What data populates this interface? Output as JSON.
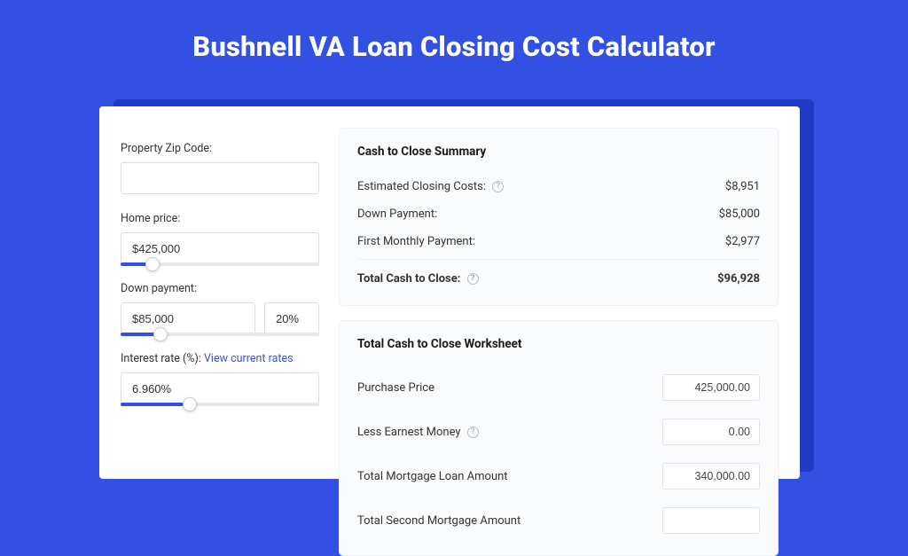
{
  "title": "Bushnell VA Loan Closing Cost Calculator",
  "left": {
    "zip": {
      "label": "Property Zip Code:",
      "value": ""
    },
    "price": {
      "label": "Home price:",
      "value": "$425,000",
      "slider_pct": 16
    },
    "down": {
      "label": "Down payment:",
      "value": "$85,000",
      "pct": "20%",
      "slider_pct": 20
    },
    "rate": {
      "label": "Interest rate (%):",
      "link": "View current rates",
      "value": "6.960%",
      "slider_pct": 35
    }
  },
  "summary": {
    "heading": "Cash to Close Summary",
    "rows": [
      {
        "label": "Estimated Closing Costs:",
        "help": true,
        "value": "$8,951"
      },
      {
        "label": "Down Payment:",
        "help": false,
        "value": "$85,000"
      },
      {
        "label": "First Monthly Payment:",
        "help": false,
        "value": "$2,977"
      }
    ],
    "total": {
      "label": "Total Cash to Close:",
      "help": true,
      "value": "$96,928"
    }
  },
  "worksheet": {
    "heading": "Total Cash to Close Worksheet",
    "rows": [
      {
        "label": "Purchase Price",
        "help": false,
        "value": "425,000.00"
      },
      {
        "label": "Less Earnest Money",
        "help": true,
        "value": "0.00"
      },
      {
        "label": "Total Mortgage Loan Amount",
        "help": false,
        "value": "340,000.00"
      },
      {
        "label": "Total Second Mortgage Amount",
        "help": false,
        "value": ""
      }
    ]
  }
}
